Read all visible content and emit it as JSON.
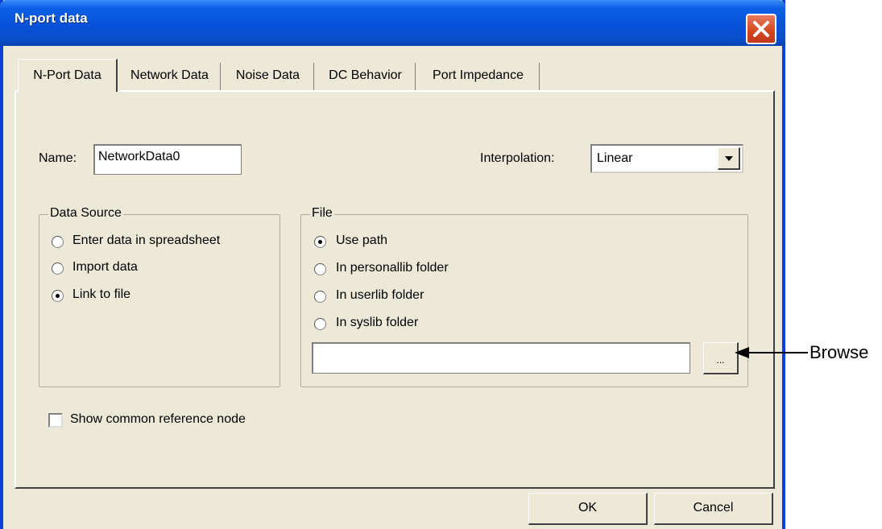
{
  "window": {
    "title": "N-port data"
  },
  "tabs": [
    {
      "label": "N-Port Data"
    },
    {
      "label": "Network Data"
    },
    {
      "label": "Noise Data"
    },
    {
      "label": "DC Behavior"
    },
    {
      "label": "Port Impedance"
    }
  ],
  "form": {
    "name_label": "Name:",
    "name_value": "NetworkData0",
    "interpolation_label": "Interpolation:",
    "interpolation_value": "Linear"
  },
  "data_source": {
    "title": "Data Source",
    "options": [
      {
        "label": "Enter data in spreadsheet",
        "checked": false
      },
      {
        "label": "Import data",
        "checked": false
      },
      {
        "label": "Link to file",
        "checked": true
      }
    ]
  },
  "file_group": {
    "title": "File",
    "options": [
      {
        "label": "Use path",
        "checked": true
      },
      {
        "label": "In personallib folder",
        "checked": false
      },
      {
        "label": "In userlib folder",
        "checked": false
      },
      {
        "label": "In syslib folder",
        "checked": false
      }
    ],
    "path_value": "",
    "browse_button_label": "..."
  },
  "show_common_reference_node": {
    "label": "Show common reference node",
    "checked": false
  },
  "buttons": {
    "ok": "OK",
    "cancel": "Cancel"
  },
  "annotation": {
    "text": "Browse"
  }
}
